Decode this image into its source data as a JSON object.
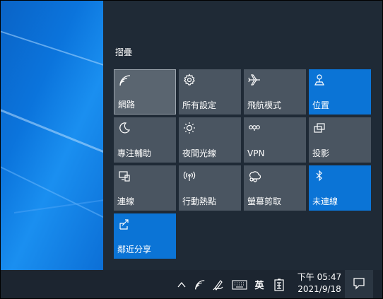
{
  "action_center": {
    "section_title": "摺疊",
    "tiles": [
      {
        "label": "網路",
        "icon": "wifi-icon",
        "state": "focused"
      },
      {
        "label": "所有設定",
        "icon": "gear-icon",
        "state": "off"
      },
      {
        "label": "飛航模式",
        "icon": "airplane-icon",
        "state": "off"
      },
      {
        "label": "位置",
        "icon": "location-icon",
        "state": "on"
      },
      {
        "label": "專注輔助",
        "icon": "moon-icon",
        "state": "off"
      },
      {
        "label": "夜間光線",
        "icon": "brightness-icon",
        "state": "off"
      },
      {
        "label": "VPN",
        "icon": "vpn-icon",
        "state": "off"
      },
      {
        "label": "投影",
        "icon": "project-icon",
        "state": "off"
      },
      {
        "label": "連線",
        "icon": "connect-icon",
        "state": "off"
      },
      {
        "label": "行動熱點",
        "icon": "hotspot-icon",
        "state": "off"
      },
      {
        "label": "螢幕剪取",
        "icon": "snip-icon",
        "state": "off"
      },
      {
        "label": "未連線",
        "icon": "bluetooth-icon",
        "state": "on"
      },
      {
        "label": "鄰近分享",
        "icon": "nearby-share-icon",
        "state": "on"
      }
    ]
  },
  "taskbar": {
    "input_language": "英",
    "clock_time": "下午 05:47",
    "clock_date": "2021/9/18"
  },
  "colors": {
    "panel_bg": "#1f2a36",
    "tile_off": "#4a5561",
    "tile_on": "#0b74d6",
    "taskbar_bg": "#1c2530"
  }
}
